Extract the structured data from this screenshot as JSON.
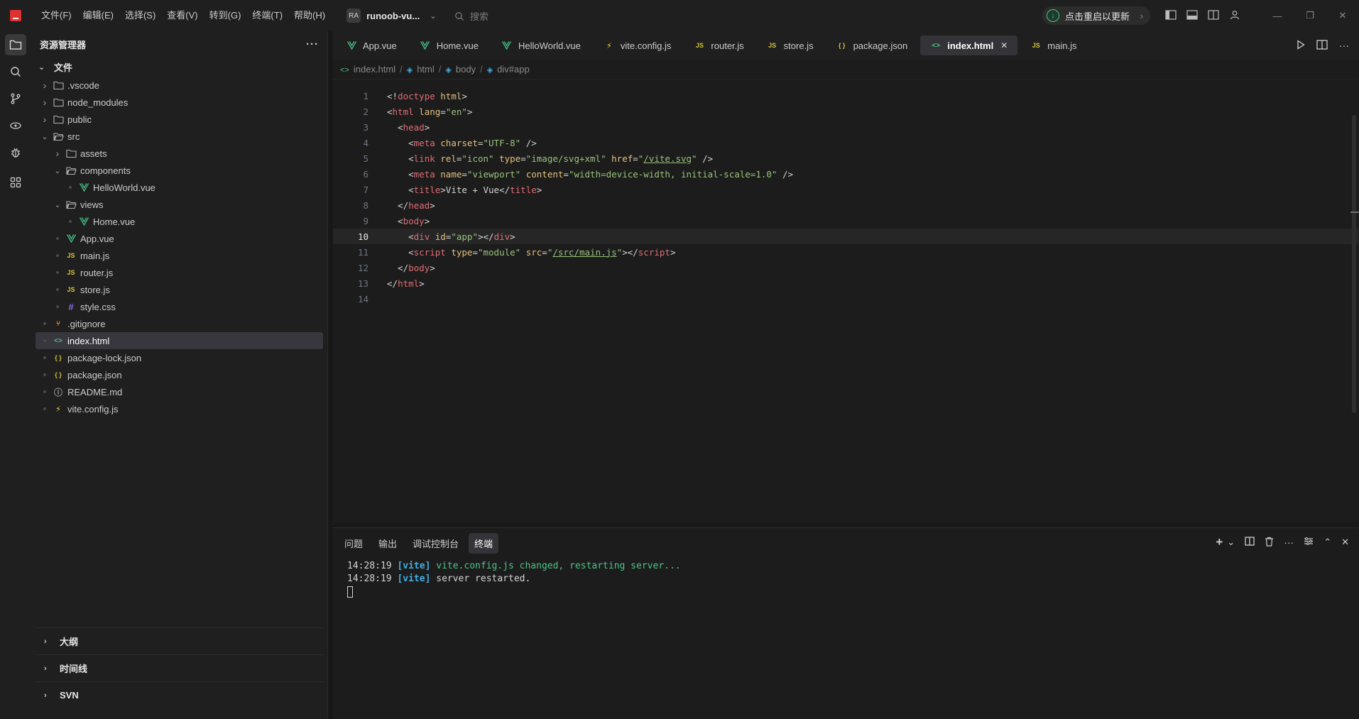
{
  "menu": [
    "文件(F)",
    "编辑(E)",
    "选择(S)",
    "查看(V)",
    "转到(G)",
    "终端(T)",
    "帮助(H)"
  ],
  "project": {
    "badge": "RA",
    "name": "runoob-vu..."
  },
  "search": {
    "placeholder": "搜索"
  },
  "update": {
    "label": "点击重启以更新"
  },
  "explorer": {
    "title": "资源管理器",
    "section": "文件",
    "tree": [
      {
        "name": ".vscode",
        "type": "folder",
        "depth": 0,
        "expanded": false
      },
      {
        "name": "node_modules",
        "type": "folder",
        "depth": 0,
        "expanded": false
      },
      {
        "name": "public",
        "type": "folder",
        "depth": 0,
        "expanded": false
      },
      {
        "name": "src",
        "type": "folder",
        "depth": 0,
        "expanded": true
      },
      {
        "name": "assets",
        "type": "folder",
        "depth": 1,
        "expanded": false
      },
      {
        "name": "components",
        "type": "folder",
        "depth": 1,
        "expanded": true
      },
      {
        "name": "HelloWorld.vue",
        "type": "vue",
        "depth": 2
      },
      {
        "name": "views",
        "type": "folder",
        "depth": 1,
        "expanded": true
      },
      {
        "name": "Home.vue",
        "type": "vue",
        "depth": 2
      },
      {
        "name": "App.vue",
        "type": "vue",
        "depth": 1
      },
      {
        "name": "main.js",
        "type": "js",
        "depth": 1
      },
      {
        "name": "router.js",
        "type": "js",
        "depth": 1
      },
      {
        "name": "store.js",
        "type": "js",
        "depth": 1
      },
      {
        "name": "style.css",
        "type": "css",
        "depth": 1
      },
      {
        "name": ".gitignore",
        "type": "git",
        "depth": 0
      },
      {
        "name": "index.html",
        "type": "html",
        "depth": 0,
        "selected": true
      },
      {
        "name": "package-lock.json",
        "type": "json",
        "depth": 0
      },
      {
        "name": "package.json",
        "type": "json",
        "depth": 0
      },
      {
        "name": "README.md",
        "type": "md",
        "depth": 0
      },
      {
        "name": "vite.config.js",
        "type": "vite",
        "depth": 0
      }
    ],
    "bottom_sections": [
      "大纲",
      "时间线",
      "SVN"
    ]
  },
  "tabs": [
    {
      "label": "App.vue",
      "type": "vue"
    },
    {
      "label": "Home.vue",
      "type": "vue"
    },
    {
      "label": "HelloWorld.vue",
      "type": "vue"
    },
    {
      "label": "vite.config.js",
      "type": "vite"
    },
    {
      "label": "router.js",
      "type": "js"
    },
    {
      "label": "store.js",
      "type": "js"
    },
    {
      "label": "package.json",
      "type": "json"
    },
    {
      "label": "index.html",
      "type": "html",
      "active": true
    },
    {
      "label": "main.js",
      "type": "js"
    }
  ],
  "breadcrumb": [
    "index.html",
    "html",
    "body",
    "div#app"
  ],
  "code": {
    "current_line": 10,
    "lines": [
      [
        [
          "p",
          "<!"
        ],
        [
          "tag",
          "doctype"
        ],
        [
          "p",
          " "
        ],
        [
          "attr",
          "html"
        ],
        [
          "p",
          ">"
        ]
      ],
      [
        [
          "p",
          "<"
        ],
        [
          "tag",
          "html"
        ],
        [
          "p",
          " "
        ],
        [
          "attr",
          "lang"
        ],
        [
          "p",
          "="
        ],
        [
          "str",
          "\"en\""
        ],
        [
          "p",
          ">"
        ]
      ],
      [
        [
          "p",
          "  <"
        ],
        [
          "tag",
          "head"
        ],
        [
          "p",
          ">"
        ]
      ],
      [
        [
          "p",
          "    <"
        ],
        [
          "tag",
          "meta"
        ],
        [
          "p",
          " "
        ],
        [
          "attr",
          "charset"
        ],
        [
          "p",
          "="
        ],
        [
          "str",
          "\"UTF-8\""
        ],
        [
          "p",
          " />"
        ]
      ],
      [
        [
          "p",
          "    <"
        ],
        [
          "tag",
          "link"
        ],
        [
          "p",
          " "
        ],
        [
          "attr",
          "rel"
        ],
        [
          "p",
          "="
        ],
        [
          "str",
          "\"icon\""
        ],
        [
          "p",
          " "
        ],
        [
          "attr",
          "type"
        ],
        [
          "p",
          "="
        ],
        [
          "str",
          "\"image/svg+xml\""
        ],
        [
          "p",
          " "
        ],
        [
          "attr",
          "href"
        ],
        [
          "p",
          "="
        ],
        [
          "str",
          "\""
        ],
        [
          "link",
          "/vite.svg"
        ],
        [
          "str",
          "\""
        ],
        [
          "p",
          " />"
        ]
      ],
      [
        [
          "p",
          "    <"
        ],
        [
          "tag",
          "meta"
        ],
        [
          "p",
          " "
        ],
        [
          "attr",
          "name"
        ],
        [
          "p",
          "="
        ],
        [
          "str",
          "\"viewport\""
        ],
        [
          "p",
          " "
        ],
        [
          "attr",
          "content"
        ],
        [
          "p",
          "="
        ],
        [
          "str",
          "\"width=device-width, initial-scale=1.0\""
        ],
        [
          "p",
          " />"
        ]
      ],
      [
        [
          "p",
          "    <"
        ],
        [
          "tag",
          "title"
        ],
        [
          "p",
          ">Vite + Vue</"
        ],
        [
          "tag",
          "title"
        ],
        [
          "p",
          ">"
        ]
      ],
      [
        [
          "p",
          "  </"
        ],
        [
          "tag",
          "head"
        ],
        [
          "p",
          ">"
        ]
      ],
      [
        [
          "p",
          "  <"
        ],
        [
          "tag",
          "body"
        ],
        [
          "p",
          ">"
        ]
      ],
      [
        [
          "p",
          "    <"
        ],
        [
          "tag",
          "div"
        ],
        [
          "p",
          " "
        ],
        [
          "attr",
          "id"
        ],
        [
          "p",
          "="
        ],
        [
          "str",
          "\"app\""
        ],
        [
          "p",
          "></"
        ],
        [
          "tag",
          "div"
        ],
        [
          "p",
          ">"
        ]
      ],
      [
        [
          "p",
          "    <"
        ],
        [
          "tag",
          "script"
        ],
        [
          "p",
          " "
        ],
        [
          "attr",
          "type"
        ],
        [
          "p",
          "="
        ],
        [
          "str",
          "\"module\""
        ],
        [
          "p",
          " "
        ],
        [
          "attr",
          "src"
        ],
        [
          "p",
          "="
        ],
        [
          "str",
          "\""
        ],
        [
          "link",
          "/src/main.js"
        ],
        [
          "str",
          "\""
        ],
        [
          "p",
          "></"
        ],
        [
          "tag",
          "script"
        ],
        [
          "p",
          ">"
        ]
      ],
      [
        [
          "p",
          "  </"
        ],
        [
          "tag",
          "body"
        ],
        [
          "p",
          ">"
        ]
      ],
      [
        [
          "p",
          "</"
        ],
        [
          "tag",
          "html"
        ],
        [
          "p",
          ">"
        ]
      ],
      [
        [
          "p",
          ""
        ]
      ]
    ]
  },
  "panel": {
    "tabs": [
      "问题",
      "输出",
      "调试控制台",
      "终端"
    ],
    "active_tab": "终端",
    "terminal": [
      {
        "time": "14:28:19",
        "tag": "[vite]",
        "msg": "vite.config.js changed, restarting server...",
        "msg_color": "green"
      },
      {
        "time": "14:28:19",
        "tag": "[vite]",
        "msg": "server restarted.",
        "msg_color": "default"
      }
    ]
  },
  "colors": {
    "accent_green": "#4ec28a",
    "vue_green": "#42b883",
    "js_yellow": "#d6c23a",
    "tag_red": "#e06c75",
    "terminal_tag": "#3fb0e6"
  }
}
